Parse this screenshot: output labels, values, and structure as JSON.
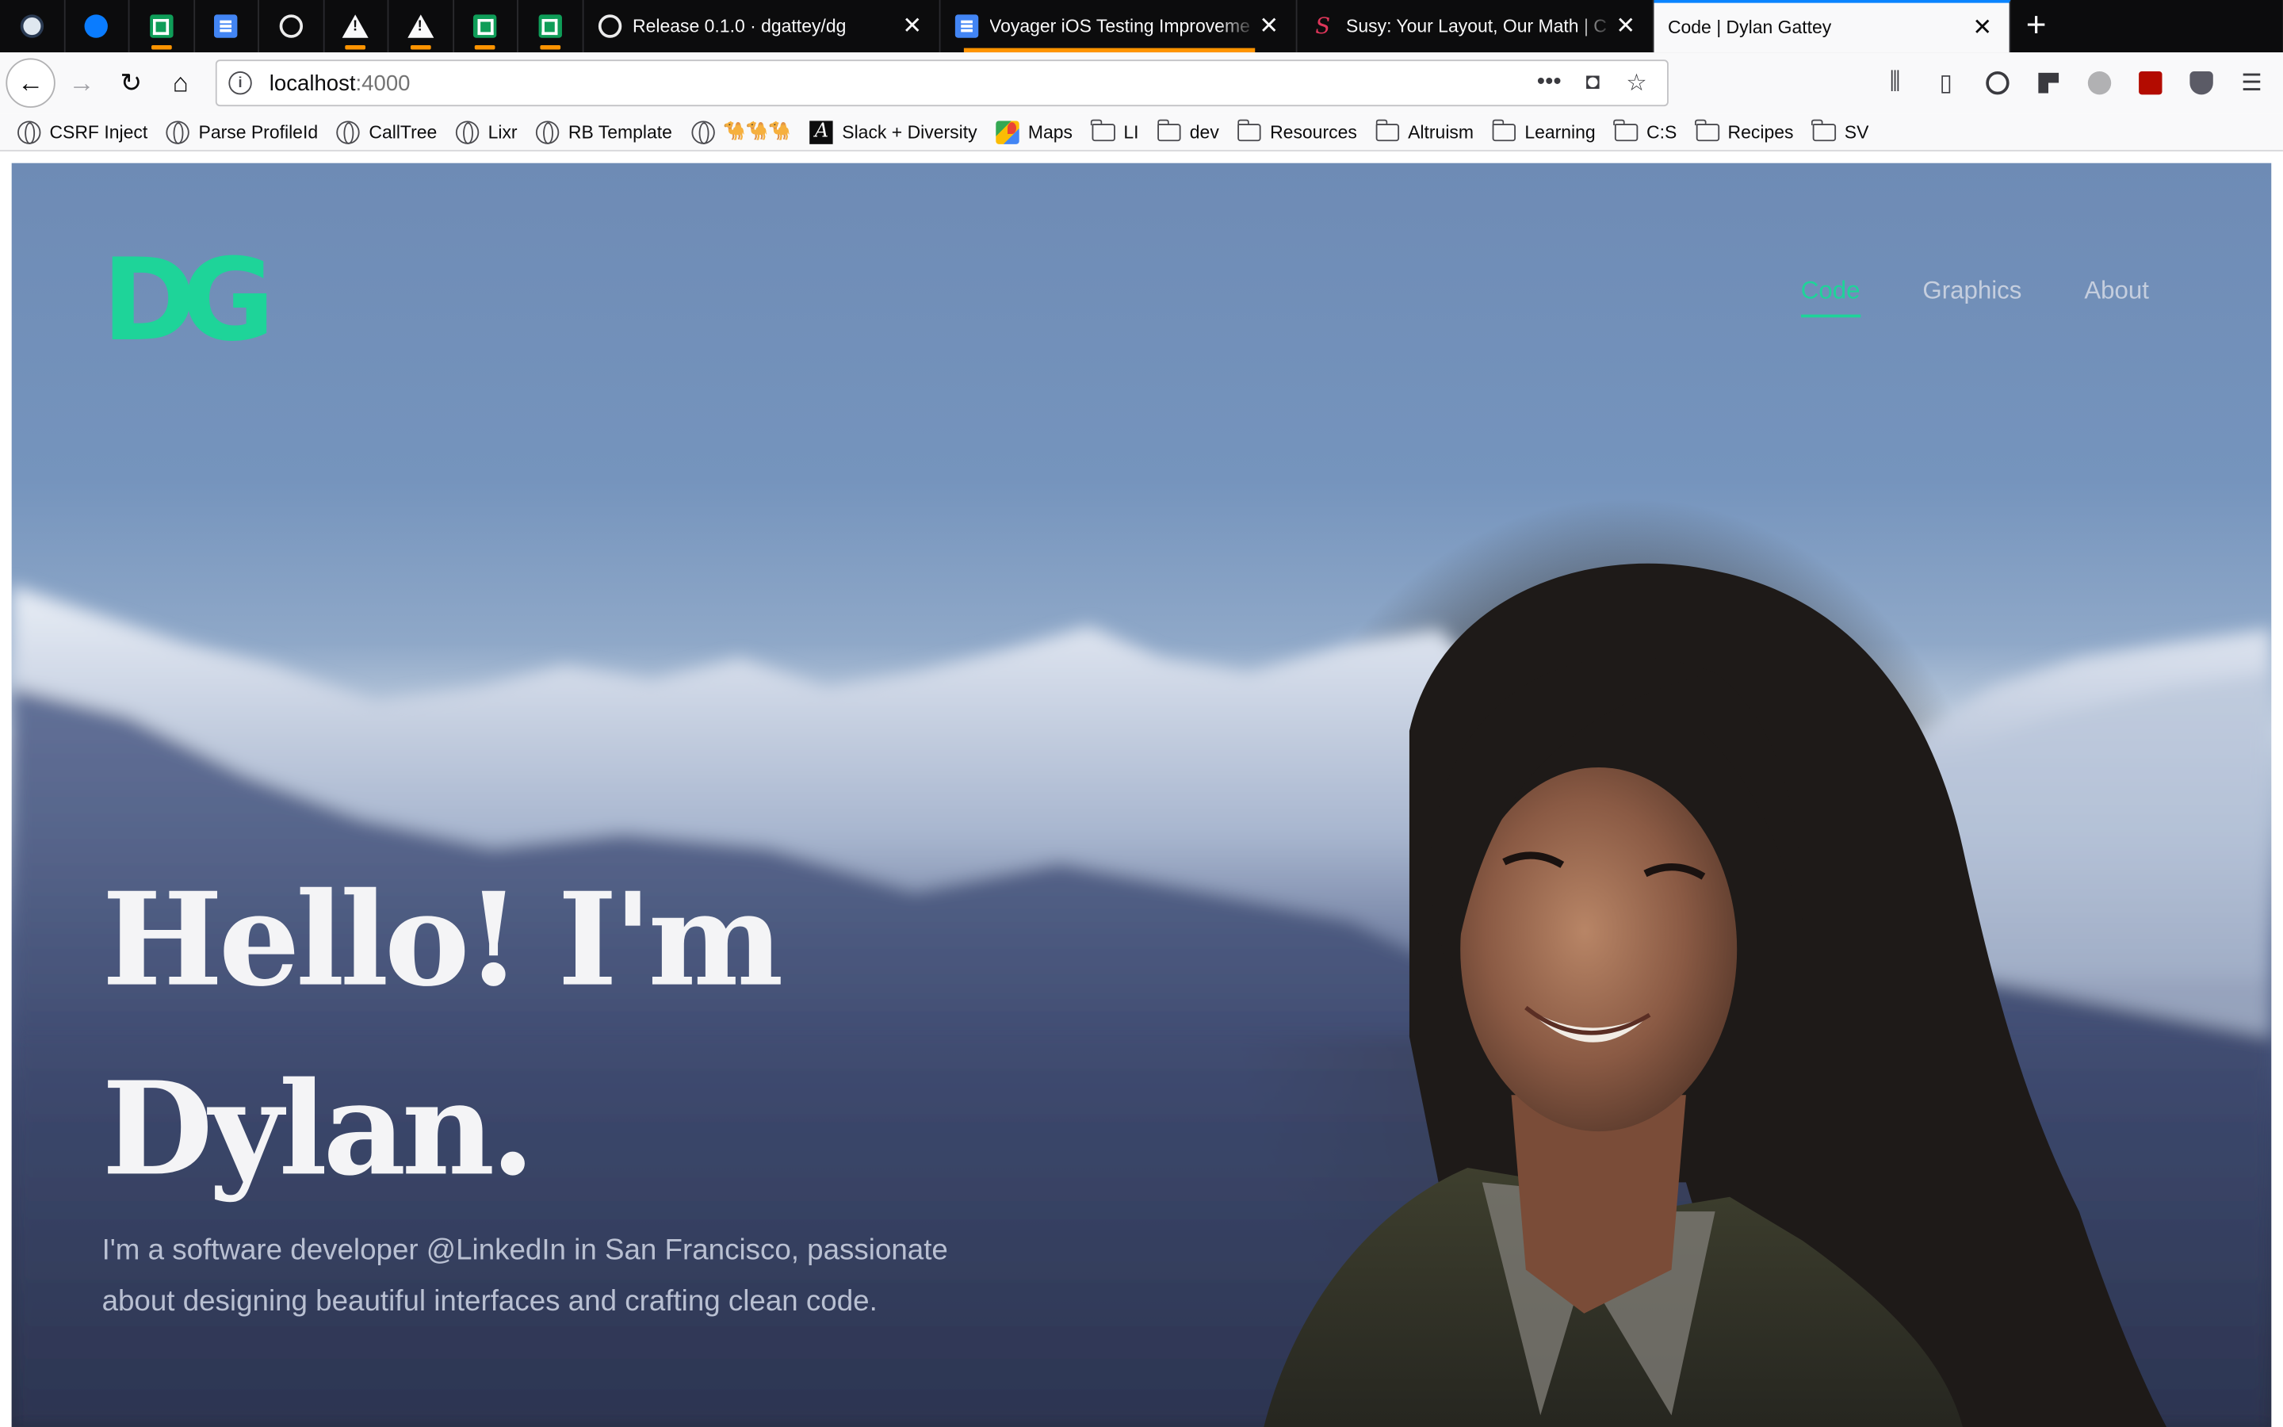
{
  "browser": {
    "pinned_tabs": [
      {
        "icon": "linkedin-home-icon"
      },
      {
        "icon": "messenger-icon"
      },
      {
        "icon": "google-sheets-icon",
        "notification": true
      },
      {
        "icon": "google-docs-icon"
      },
      {
        "icon": "github-icon"
      },
      {
        "icon": "warning-icon",
        "notification": true
      },
      {
        "icon": "warning-icon",
        "notification": true
      },
      {
        "icon": "google-sheets-icon",
        "notification": true
      },
      {
        "icon": "google-sheets-icon",
        "notification": true
      }
    ],
    "tabs": [
      {
        "title": "Release 0.1.0 · dgattey/dg",
        "icon": "github-icon"
      },
      {
        "title": "Voyager iOS Testing Improveme",
        "icon": "google-docs-icon"
      },
      {
        "title": "Susy: Your Layout, Our Math | C",
        "icon": "susy-icon"
      },
      {
        "title": "Code | Dylan Gattey",
        "icon": "none",
        "active": true
      }
    ],
    "new_tab_label": "+",
    "close_glyph": "✕",
    "url": {
      "host": "localhost",
      "port": ":4000"
    },
    "url_actions": {
      "more": "•••"
    }
  },
  "bookmarks": [
    {
      "label": "CSRF Inject",
      "icon": "globe"
    },
    {
      "label": "Parse ProfileId",
      "icon": "globe"
    },
    {
      "label": "CallTree",
      "icon": "globe"
    },
    {
      "label": "Lixr",
      "icon": "globe"
    },
    {
      "label": "RB Template",
      "icon": "globe"
    },
    {
      "label": "🐪🐪🐪",
      "icon": "globe"
    },
    {
      "label": "Slack + Diversity",
      "icon": "slack-a"
    },
    {
      "label": "Maps",
      "icon": "maps"
    },
    {
      "label": "LI",
      "icon": "folder"
    },
    {
      "label": "dev",
      "icon": "folder"
    },
    {
      "label": "Resources",
      "icon": "folder"
    },
    {
      "label": "Altruism",
      "icon": "folder"
    },
    {
      "label": "Learning",
      "icon": "folder"
    },
    {
      "label": "C:S",
      "icon": "folder"
    },
    {
      "label": "Recipes",
      "icon": "folder"
    },
    {
      "label": "SV",
      "icon": "folder"
    }
  ],
  "site": {
    "logo": "DG",
    "nav": [
      {
        "label": "Code",
        "active": true
      },
      {
        "label": "Graphics",
        "active": false
      },
      {
        "label": "About",
        "active": false
      }
    ],
    "hero": {
      "title_line1": "Hello! I'm",
      "title_line2": "Dylan.",
      "subtitle": "I'm a software developer @LinkedIn in San Francisco, passionate about designing beautiful interfaces and crafting clean code."
    },
    "colors": {
      "accent": "#1ed499"
    }
  }
}
